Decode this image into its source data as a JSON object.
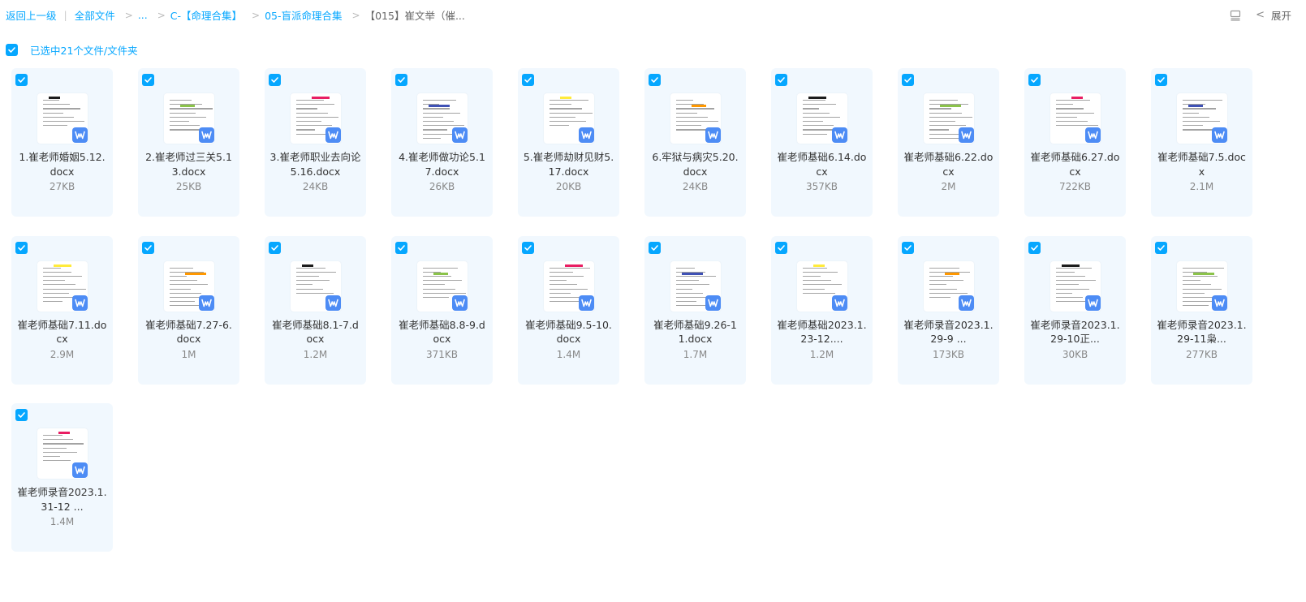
{
  "breadcrumb": {
    "back": "返回上一级",
    "all_files": "全部文件",
    "ellipsis": "...",
    "level1": "C-【命理合集】",
    "level2": "05-盲派命理合集",
    "current": "【015】崔文举（催..."
  },
  "toolbar": {
    "expand_label": "展开"
  },
  "selection": {
    "label": "已选中21个文件/文件夹"
  },
  "colors": {
    "accent": "#06a7ff",
    "card_bg": "#f1f8fe",
    "word_badge": "#4d8cf5"
  },
  "files": [
    {
      "name": "1.崔老师婚姻5.12.docx",
      "size": "27KB",
      "icon": "word-doc-icon"
    },
    {
      "name": "2.崔老师过三关5.13.docx",
      "size": "25KB",
      "icon": "word-doc-icon"
    },
    {
      "name": "3.崔老师职业去向论5.16.docx",
      "size": "24KB",
      "icon": "word-doc-icon"
    },
    {
      "name": "4.崔老师做功论5.17.docx",
      "size": "26KB",
      "icon": "word-doc-icon"
    },
    {
      "name": "5.崔老师劫财见财5.17.docx",
      "size": "20KB",
      "icon": "word-doc-icon"
    },
    {
      "name": "6.牢狱与病灾5.20.docx",
      "size": "24KB",
      "icon": "word-doc-icon"
    },
    {
      "name": "崔老师基础6.14.docx",
      "size": "357KB",
      "icon": "word-doc-icon"
    },
    {
      "name": "崔老师基础6.22.docx",
      "size": "2M",
      "icon": "word-doc-icon"
    },
    {
      "name": "崔老师基础6.27.docx",
      "size": "722KB",
      "icon": "word-doc-icon"
    },
    {
      "name": "崔老师基础7.5.docx",
      "size": "2.1M",
      "icon": "word-doc-icon"
    },
    {
      "name": "崔老师基础7.11.docx",
      "size": "2.9M",
      "icon": "word-doc-icon"
    },
    {
      "name": "崔老师基础7.27-6.docx",
      "size": "1M",
      "icon": "word-doc-icon"
    },
    {
      "name": "崔老师基础8.1-7.docx",
      "size": "1.2M",
      "icon": "word-doc-icon"
    },
    {
      "name": "崔老师基础8.8-9.docx",
      "size": "371KB",
      "icon": "word-doc-icon"
    },
    {
      "name": "崔老师基础9.5-10.docx",
      "size": "1.4M",
      "icon": "word-doc-icon"
    },
    {
      "name": "崔老师基础9.26-11.docx",
      "size": "1.7M",
      "icon": "word-doc-icon"
    },
    {
      "name": "崔老师基础2023.1.23-12....",
      "size": "1.2M",
      "icon": "word-doc-icon"
    },
    {
      "name": "崔老师录音2023.1.29-9 ...",
      "size": "173KB",
      "icon": "word-doc-icon"
    },
    {
      "name": "崔老师录音2023.1.29-10正...",
      "size": "30KB",
      "icon": "word-doc-icon"
    },
    {
      "name": "崔老师录音2023.1.29-11枭...",
      "size": "277KB",
      "icon": "word-doc-icon"
    },
    {
      "name": "崔老师录音2023.1.31-12 ...",
      "size": "1.4M",
      "icon": "word-doc-icon"
    }
  ]
}
